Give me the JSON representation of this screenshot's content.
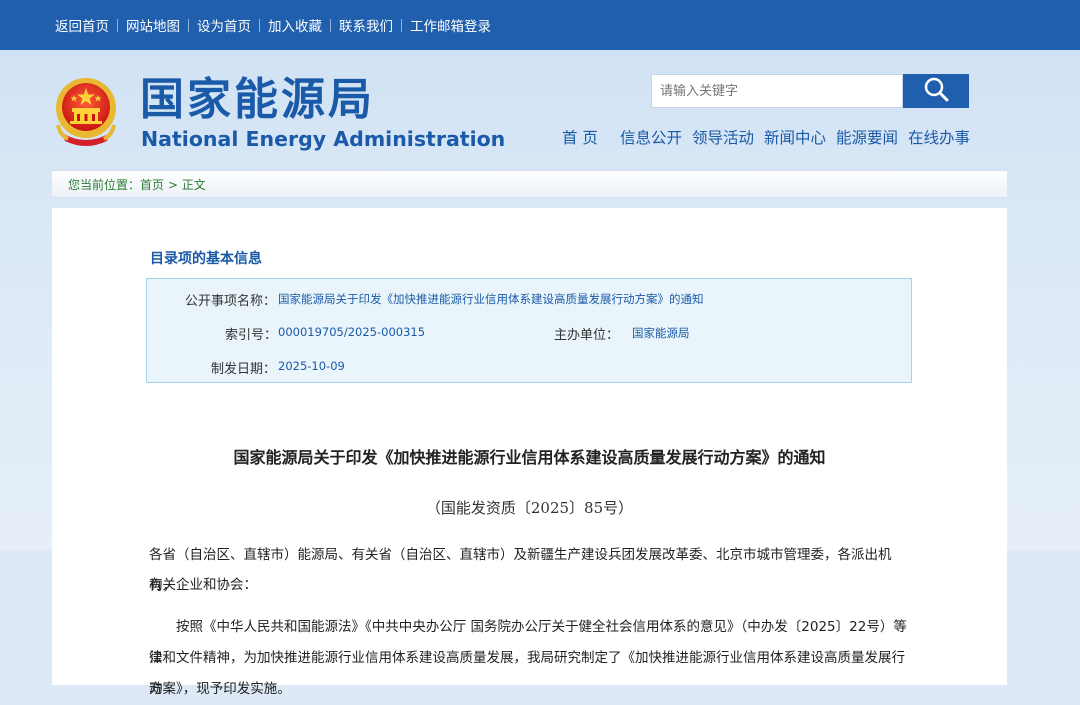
{
  "topbar": {
    "links": [
      "返回首页",
      "网站地图",
      "设为首页",
      "加入收藏",
      "联系我们",
      "工作邮箱登录"
    ]
  },
  "header": {
    "title_cn": "国家能源局",
    "title_en": "National Energy Administration",
    "search_placeholder": "请输入关键字",
    "emblem_icon": "national-emblem-icon",
    "search_icon": "search-icon",
    "nav": [
      "首 页",
      "信息公开",
      "领导活动",
      "新闻中心",
      "能源要闻",
      "在线办事"
    ]
  },
  "breadcrumb": {
    "prefix": "您当前位置：",
    "home": "首页",
    "separator": ">",
    "current": "正文"
  },
  "info": {
    "section_title": "目录项的基本信息",
    "name_label": "公开事项名称：",
    "name_value": "国家能源局关于印发《加快推进能源行业信用体系建设高质量发展行动方案》的通知",
    "index_label": "索引号：",
    "index_value": "000019705/2025-000315",
    "dept_label": "主办单位：",
    "dept_value": "国家能源局",
    "date_label": "制发日期：",
    "date_value": "2025-10-09"
  },
  "document": {
    "title": "国家能源局关于印发《加快推进能源行业信用体系建设高质量发展行动方案》的通知",
    "number": "（国能发资质〔2025〕85号）",
    "recipients_line1": "各省（自治区、直辖市）能源局、有关省（自治区、直辖市）及新疆生产建设兵团发展改革委、北京市城市管理委，各派出机构，",
    "recipients_line2": "有关企业和协会：",
    "body_line1": "按照《中华人民共和国能源法》《中共中央办公厅 国务院办公厅关于健全社会信用体系的意见》（中办发〔2025〕22号）等法",
    "body_line2": "律和文件精神，为加快推进能源行业信用体系建设高质量发展，我局研究制定了《加快推进能源行业信用体系建设高质量发展行动",
    "body_line3": "方案》，现予印发实施。"
  },
  "colors": {
    "brand_blue": "#1f5fae",
    "text_blue": "#1a5aa8",
    "breadcrumb_green": "#2e7d32",
    "info_bg": "#eaf5fb"
  }
}
